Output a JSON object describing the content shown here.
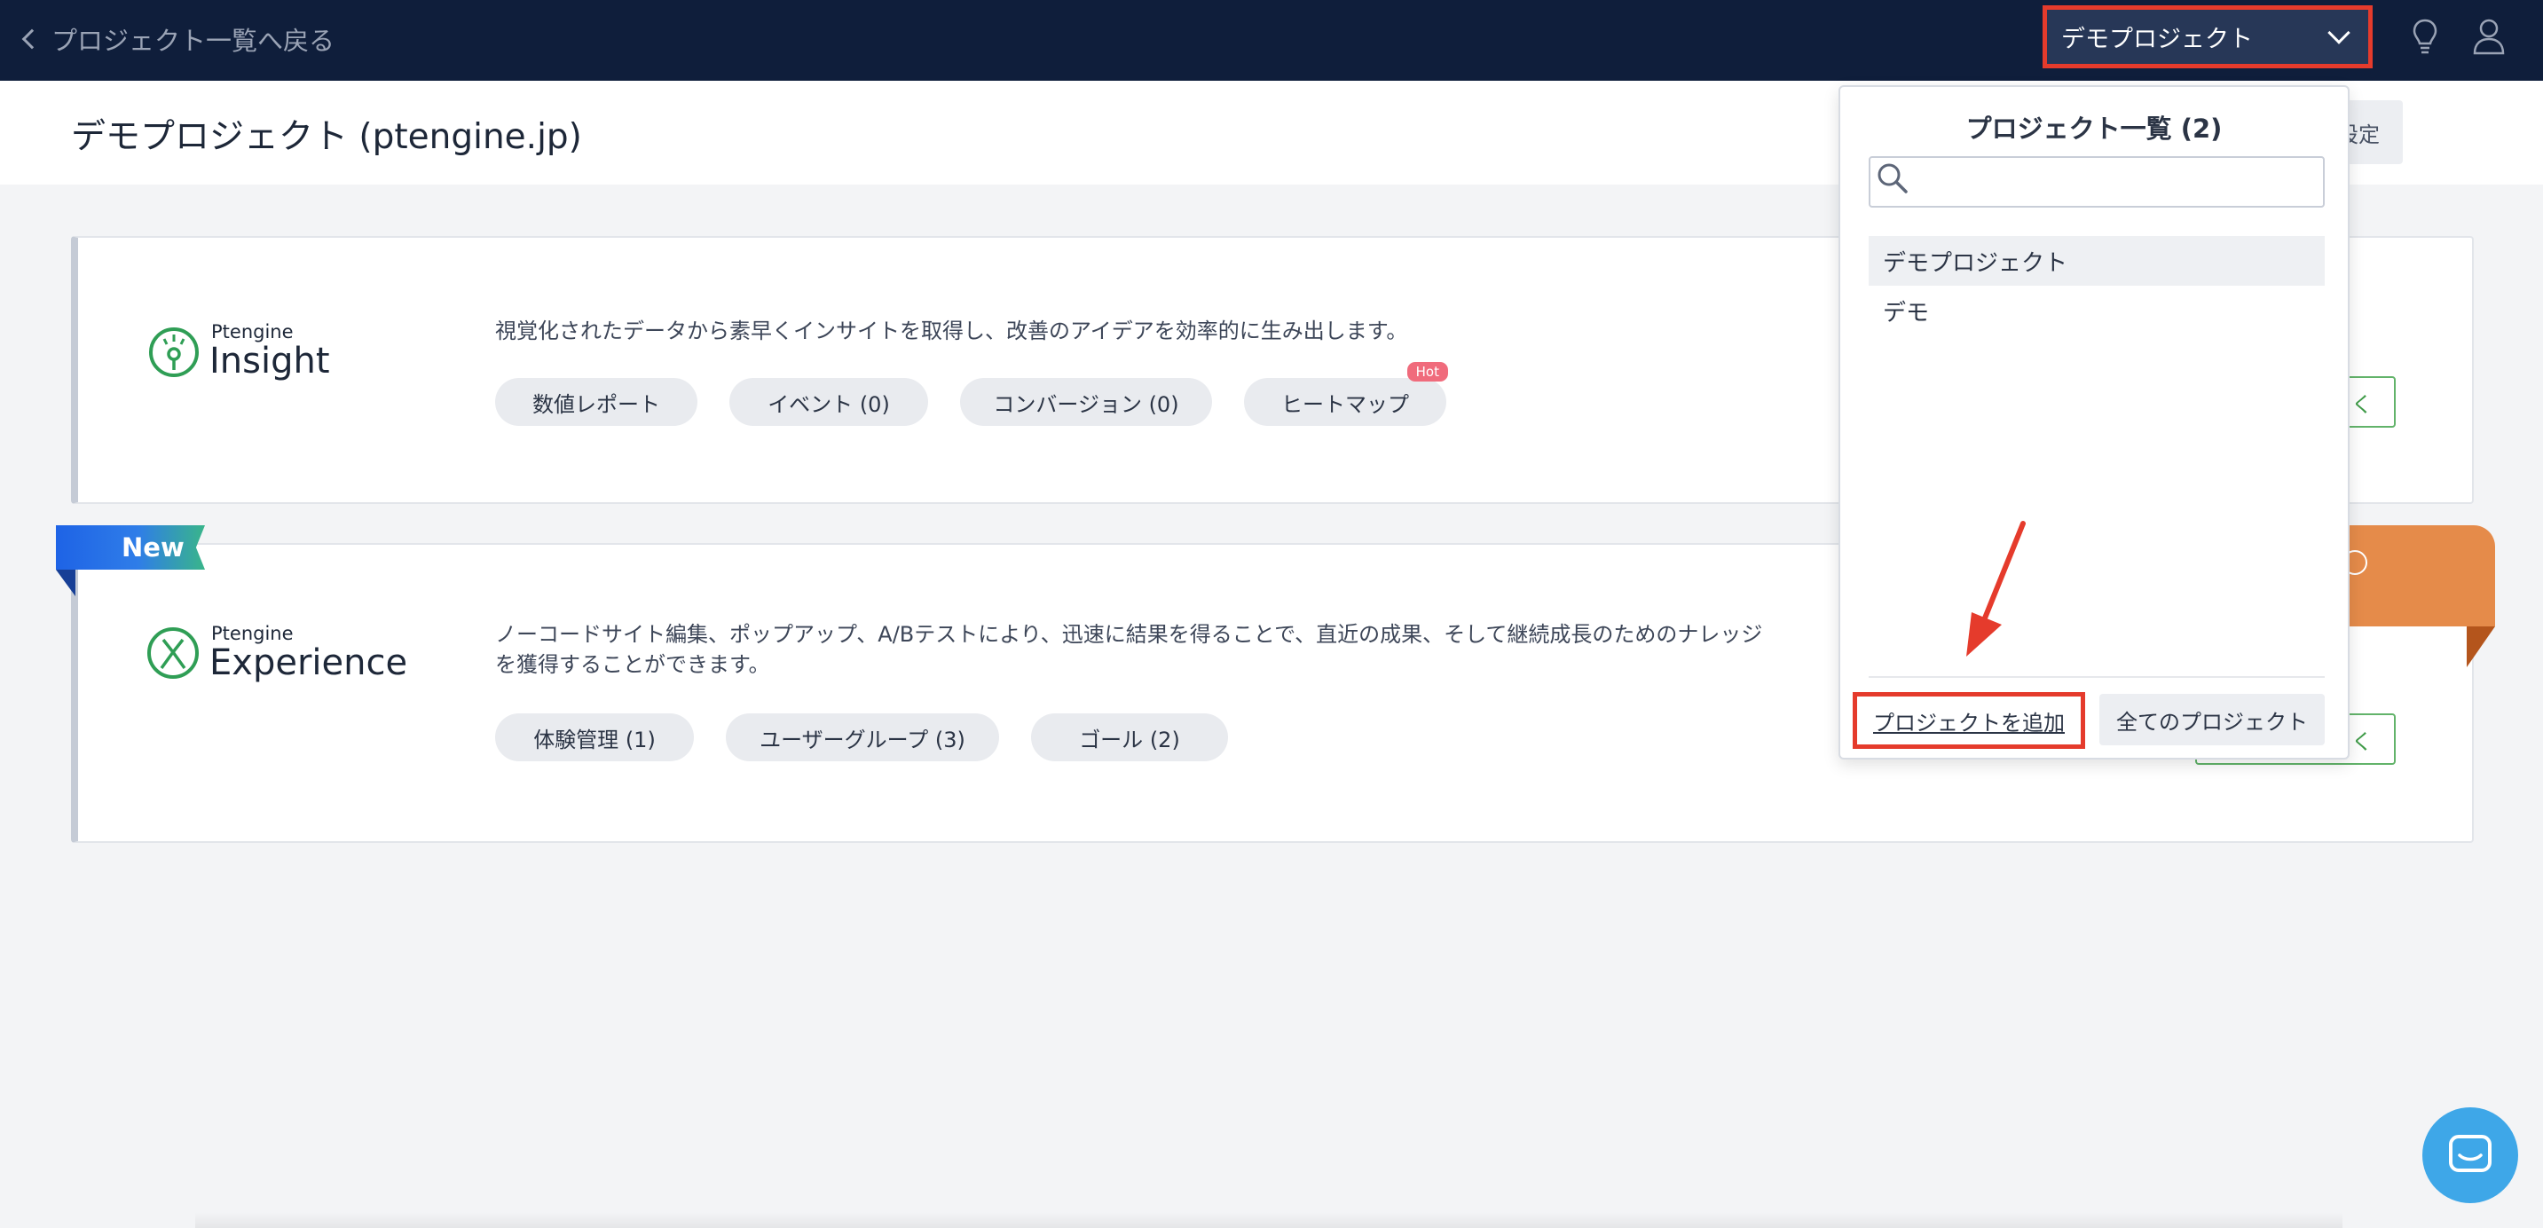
{
  "topbar": {
    "back_label": "プロジェクト一覧へ戻る",
    "project_select_label": "デモプロジェクト"
  },
  "header": {
    "title": "デモプロジェクト (ptengine.jp)",
    "settings_label": "設定"
  },
  "insight": {
    "logo_small": "Ptengine",
    "logo_big": "Insight",
    "description": "視覚化されたデータから素早くインサイトを取得し、改善のアイデアを効率的に生み出します。",
    "chips": [
      "数値レポート",
      "イベント (0)",
      "コンバージョン (0)",
      "ヒートマップ"
    ],
    "hot_badge": "Hot",
    "open_label": "く"
  },
  "experience": {
    "ribbon": "New",
    "logo_small": "Ptengine",
    "logo_big": "Experience",
    "description_line1": "ノーコードサイト編集、ポップアップ、A/Bテストにより、迅速に結果を得ることで、直近の成果、そして継続成長のためのナレッジ",
    "description_line2": "を獲得することができます。",
    "chips": [
      "体験管理 (1)",
      "ユーザーグループ (3)",
      "ゴール (2)"
    ],
    "open_label": "開く"
  },
  "dropdown": {
    "title": "プロジェクト一覧 (2)",
    "search_placeholder": "",
    "projects": [
      "デモプロジェクト",
      "デモ"
    ],
    "add_project_label": "プロジェクトを追加",
    "all_projects_label": "全てのプロジェクト"
  },
  "colors": {
    "topbar": "#0f1e3b",
    "highlight": "#e53b2c",
    "accent_green": "#3f9b48",
    "chat": "#3ea7e8",
    "orange": "#e58b4a"
  },
  "icons": [
    "chevron-left-icon",
    "chevron-down-icon",
    "lightbulb-icon",
    "user-icon",
    "search-icon",
    "chat-icon",
    "arrow-icon"
  ]
}
